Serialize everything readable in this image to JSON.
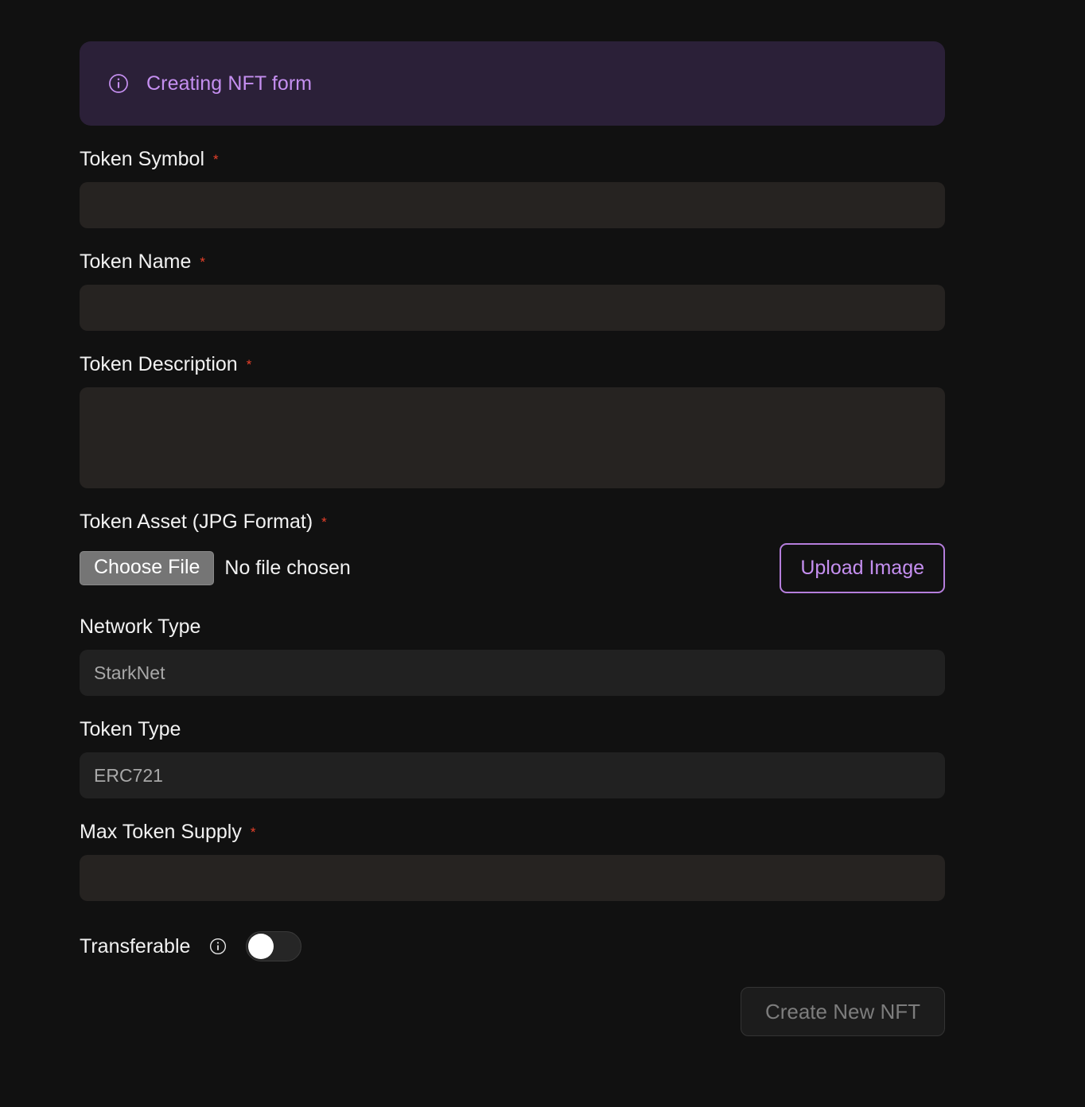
{
  "banner": {
    "icon": "info-circle-icon",
    "text": "Creating NFT form"
  },
  "fields": {
    "token_symbol": {
      "label": "Token Symbol",
      "required_marker": "*",
      "value": "",
      "placeholder": ""
    },
    "token_name": {
      "label": "Token Name",
      "required_marker": "*",
      "value": "",
      "placeholder": ""
    },
    "token_description": {
      "label": "Token Description",
      "required_marker": "*",
      "value": "",
      "placeholder": ""
    },
    "token_asset": {
      "label": "Token Asset (JPG Format)",
      "required_marker": "*",
      "choose_file_label": "Choose File",
      "file_status": "No file chosen",
      "upload_button_label": "Upload Image"
    },
    "network_type": {
      "label": "Network Type",
      "selected": "StarkNet"
    },
    "token_type": {
      "label": "Token Type",
      "selected": "ERC721"
    },
    "max_token_supply": {
      "label": "Max Token Supply",
      "required_marker": "*",
      "value": "",
      "placeholder": ""
    },
    "transferable": {
      "label": "Transferable",
      "info_icon": "info-circle-icon",
      "state": "off"
    }
  },
  "submit": {
    "label": "Create New NFT",
    "disabled": true
  },
  "colors": {
    "page_background": "#111111",
    "banner_background": "#2b2038",
    "accent_purple": "#c58ff0",
    "accent_purple_border": "#b57edc",
    "input_background": "#262321",
    "select_background": "#212121",
    "required_red": "#e8402a",
    "label_text": "#f2f2f2",
    "muted_text": "#a8a8a8",
    "disabled_text": "#7d7d7d",
    "choose_file_background": "#757575"
  }
}
